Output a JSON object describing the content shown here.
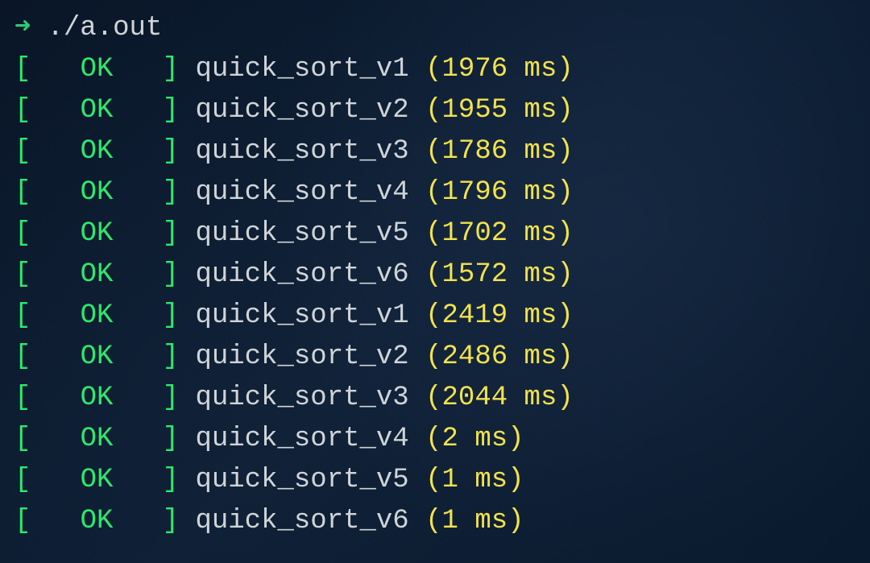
{
  "prompt": {
    "arrow": "➜",
    "command": "./a.out"
  },
  "status_label": "OK",
  "results": [
    {
      "name": "quick_sort_v1",
      "time": "1976 ms"
    },
    {
      "name": "quick_sort_v2",
      "time": "1955 ms"
    },
    {
      "name": "quick_sort_v3",
      "time": "1786 ms"
    },
    {
      "name": "quick_sort_v4",
      "time": "1796 ms"
    },
    {
      "name": "quick_sort_v5",
      "time": "1702 ms"
    },
    {
      "name": "quick_sort_v6",
      "time": "1572 ms"
    },
    {
      "name": "quick_sort_v1",
      "time": "2419 ms"
    },
    {
      "name": "quick_sort_v2",
      "time": "2486 ms"
    },
    {
      "name": "quick_sort_v3",
      "time": "2044 ms"
    },
    {
      "name": "quick_sort_v4",
      "time": "2 ms"
    },
    {
      "name": "quick_sort_v5",
      "time": "1 ms"
    },
    {
      "name": "quick_sort_v6",
      "time": "1 ms"
    }
  ]
}
